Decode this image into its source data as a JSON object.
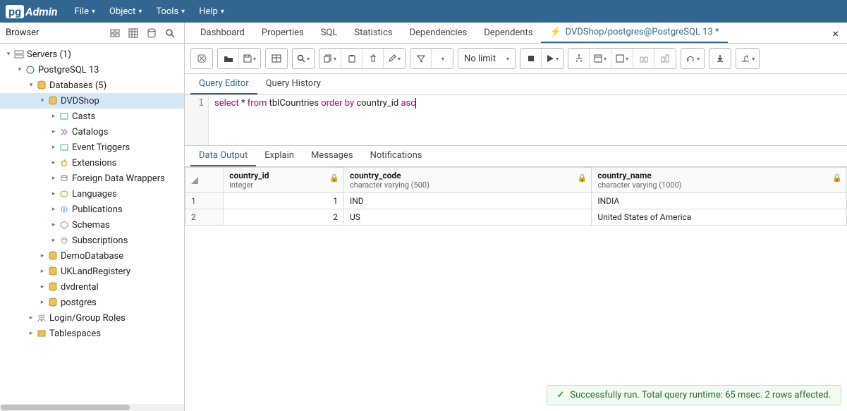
{
  "menu": {
    "file": "File",
    "object": "Object",
    "tools": "Tools",
    "help": "Help"
  },
  "browser": {
    "title": "Browser"
  },
  "tree": {
    "servers": "Servers (1)",
    "pg13": "PostgreSQL 13",
    "databases": "Databases (5)",
    "dvdshop": "DVDShop",
    "casts": "Casts",
    "catalogs": "Catalogs",
    "eventtriggers": "Event Triggers",
    "extensions": "Extensions",
    "fdw": "Foreign Data Wrappers",
    "languages": "Languages",
    "publications": "Publications",
    "schemas": "Schemas",
    "subscriptions": "Subscriptions",
    "demo": "DemoDatabase",
    "ukland": "UKLandRegistery",
    "dvdrental": "dvdrental",
    "postgres": "postgres",
    "loginroles": "Login/Group Roles",
    "tablespaces": "Tablespaces"
  },
  "tabs": {
    "dashboard": "Dashboard",
    "properties": "Properties",
    "sql": "SQL",
    "statistics": "Statistics",
    "dependencies": "Dependencies",
    "dependents": "Dependents",
    "querytool": "DVDShop/postgres@PostgreSQL 13 *"
  },
  "toolbar": {
    "nolimit": "No limit"
  },
  "editor_tabs": {
    "query": "Query Editor",
    "history": "Query History"
  },
  "sql": {
    "line1": "1",
    "select": "select",
    "star": " * ",
    "from": "from",
    "table": " tblCountries ",
    "order": "order",
    "by": " by",
    "col": " country_id ",
    "asc": "asc"
  },
  "out_tabs": {
    "data": "Data Output",
    "explain": "Explain",
    "messages": "Messages",
    "notifications": "Notifications"
  },
  "cols": {
    "c1n": "country_id",
    "c1t": "integer",
    "c2n": "country_code",
    "c2t": "character varying (500)",
    "c3n": "country_name",
    "c3t": "character varying (1000)"
  },
  "rows": {
    "r1n": "1",
    "r1_1": "1",
    "r1_2": "IND",
    "r1_3": "INDIA",
    "r2n": "2",
    "r2_1": "2",
    "r2_2": "US",
    "r2_3": "United States of America"
  },
  "status": "Successfully run. Total query runtime: 65 msec. 2 rows affected."
}
